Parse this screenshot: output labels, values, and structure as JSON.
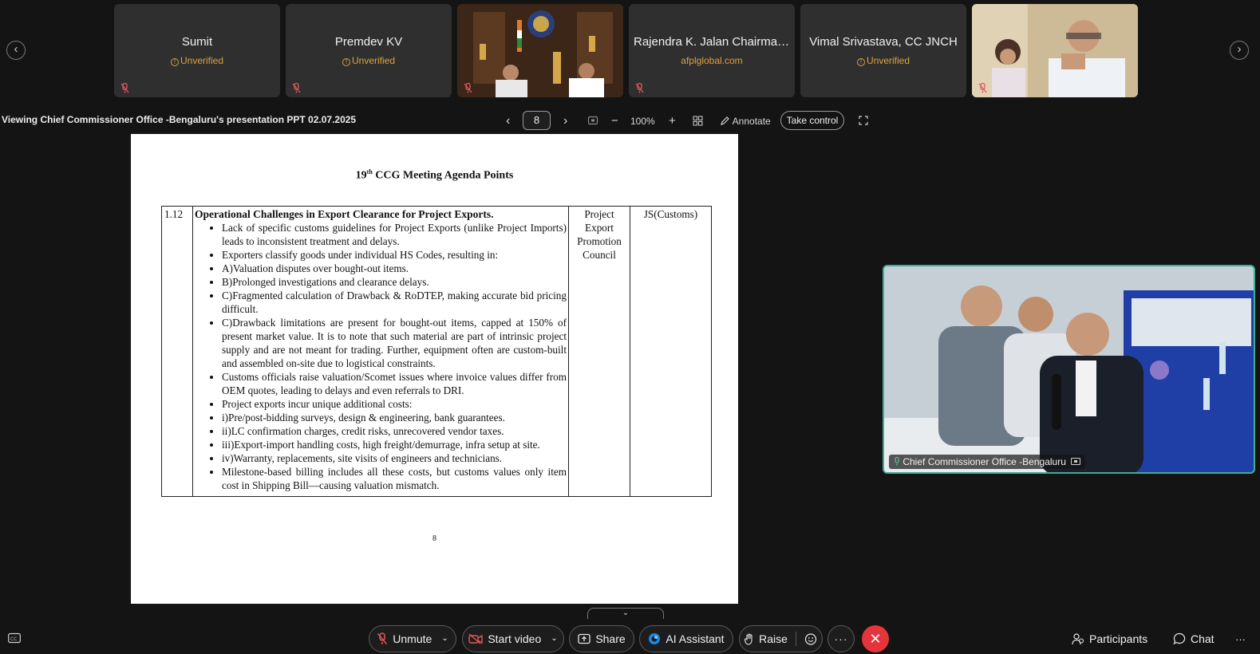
{
  "participants": [
    {
      "name": "Sumit",
      "status": "Unverified"
    },
    {
      "name": "Premdev KV",
      "status": "Unverified"
    },
    {
      "name": "Rajendra K. Jalan Chairman...",
      "status": "afplglobal.com"
    },
    {
      "name": "Vimal Srivastava, CC JNCH",
      "status": "Unverified"
    }
  ],
  "presentation": {
    "viewing_text": "Viewing Chief Commissioner Office -Bengaluru's presentation PPT 02.07.2025",
    "page": "8",
    "zoom": "100%",
    "annotate_label": "Annotate",
    "take_control_label": "Take control"
  },
  "slide": {
    "title_prefix": "19",
    "title_sup": "th",
    "title_rest": " CCG Meeting Agenda Points",
    "item_no": "1.12",
    "heading": "Operational Challenges in Export Clearance for Project Exports.",
    "bullets": [
      "Lack of specific customs guidelines for Project Exports (unlike Project Imports) leads to inconsistent treatment and delays.",
      "Exporters classify goods under individual HS Codes, resulting in:",
      "A)Valuation disputes over bought-out items.",
      "B)Prolonged investigations and clearance delays.",
      "C)Fragmented calculation of Drawback & RoDTEP, making accurate bid pricing difficult.",
      "C)Drawback limitations are present for bought-out items, capped at 150% of present market value. It is to note that such material are part of intrinsic project supply and are not meant for trading. Further, equipment often are custom-built and assembled on-site due to logistical constraints.",
      "Customs officials raise valuation/Scomet issues where invoice values differ from OEM quotes, leading to delays and even referrals to DRI.",
      "Project exports incur unique additional costs:",
      "i)Pre/post-bidding surveys, design & engineering, bank guarantees.",
      "ii)LC confirmation charges, credit risks, unrecovered vendor taxes.",
      "iii)Export-import handling costs, high freight/demurrage, infra setup at site.",
      "iv)Warranty, replacements, site visits of engineers and technicians.",
      "Milestone-based billing includes all these costs, but customs values only item cost in Shipping Bill—causing valuation mismatch."
    ],
    "raised_by": "Project Export Promotion Council",
    "responsible": "JS(Customs)",
    "page_number": "8"
  },
  "speaker": {
    "label": "Chief Commissioner Office -Bengaluru"
  },
  "controls": {
    "unmute": "Unmute",
    "start_video": "Start video",
    "share": "Share",
    "ai_assistant": "AI Assistant",
    "raise": "Raise",
    "participants": "Participants",
    "chat": "Chat"
  }
}
